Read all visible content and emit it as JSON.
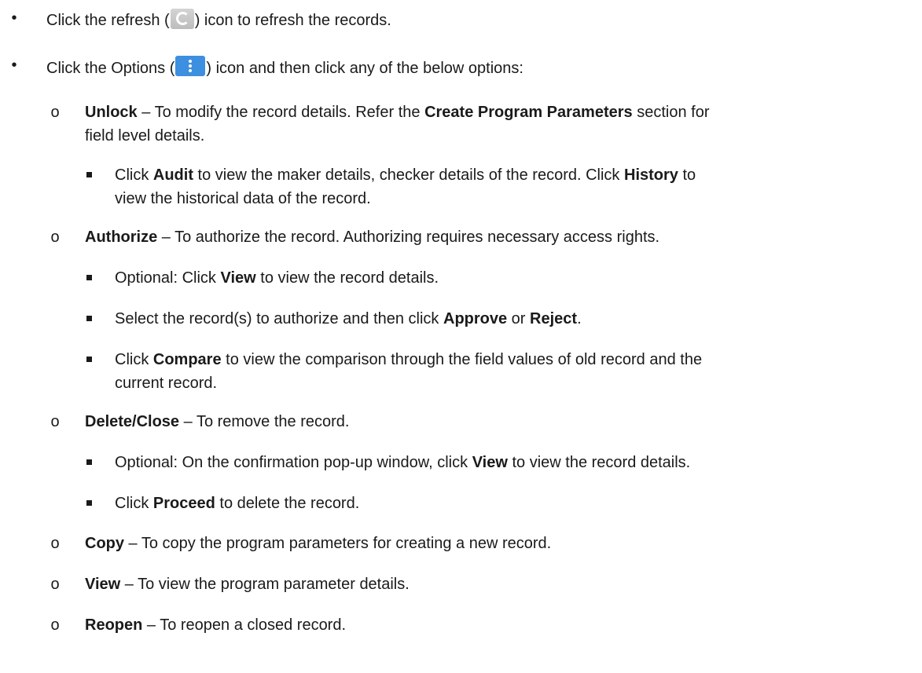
{
  "bullets": {
    "disc": "•",
    "circle": "o"
  },
  "icons": {
    "refresh": "refresh-icon",
    "options": "options-kebab-icon",
    "options_color": "#3d8fe0",
    "refresh_color": "#c8c8c8"
  },
  "items": {
    "refresh": {
      "a": "Click the refresh (",
      "b": ") icon to refresh the records."
    },
    "options": {
      "a": "Click the Options (",
      "b": ") icon and then click any of the below options:"
    },
    "unlock": {
      "term": "Unlock",
      "a": " – To modify the record details. Refer the ",
      "bold": "Create Program Parameters",
      "b": " section for",
      "line2": "field level details."
    },
    "audit": {
      "a": "Click ",
      "audit": "Audit",
      "b": " to view the maker details, checker details of the record. Click ",
      "history": "History",
      "c": " to",
      "line2": "view the historical data of the record."
    },
    "authorize": {
      "term": "Authorize",
      "a": " – To authorize the record. Authorizing requires necessary access rights."
    },
    "auth_view": {
      "a": "Optional: Click ",
      "view": "View",
      "b": " to view the record details."
    },
    "auth_select": {
      "a": "Select the record(s) to authorize and then click ",
      "approve": "Approve",
      "or": " or ",
      "reject": "Reject",
      "end": "."
    },
    "compare": {
      "a": "Click ",
      "compare": "Compare",
      "b": " to view the comparison through the field values of old record and the",
      "line2": "current record."
    },
    "delete": {
      "term": "Delete/Close",
      "a": " – To remove the record."
    },
    "delete_view": {
      "a": "Optional: On the confirmation pop-up window, click ",
      "view": "View",
      "b": " to view the record details."
    },
    "proceed": {
      "a": "Click ",
      "proceed": "Proceed",
      "b": " to delete the record."
    },
    "copy": {
      "term": "Copy",
      "a": " – To copy the program parameters for creating a new record."
    },
    "view": {
      "term": "View",
      "a": " – To view the program parameter details."
    },
    "reopen": {
      "term": "Reopen",
      "a": " – To reopen a closed record."
    }
  }
}
